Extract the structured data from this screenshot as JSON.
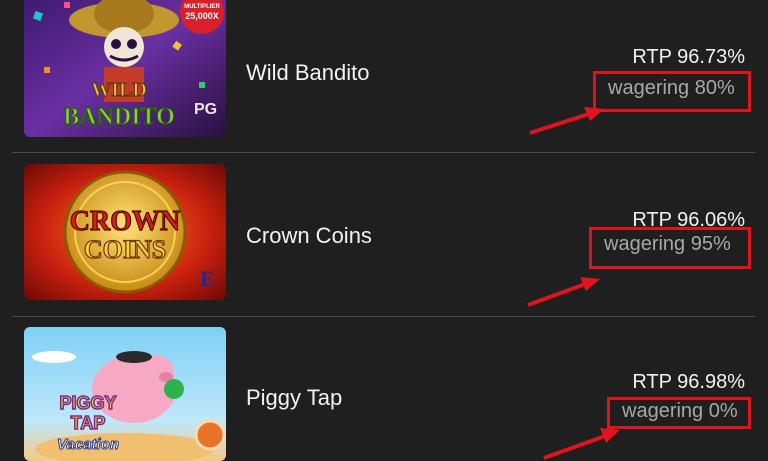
{
  "games": [
    {
      "title": "Wild Bandito",
      "rtp": "RTP 96.73%",
      "wagering": "wagering 80%",
      "thumb_text": {
        "badge_top": "MULTIPLIER",
        "badge_value": "25,000X",
        "logo_line1": "WILD",
        "logo_line2": "BANDITO",
        "provider": "PG"
      }
    },
    {
      "title": "Crown Coins",
      "rtp": "RTP 96.06%",
      "wagering": "wagering 95%",
      "thumb_text": {
        "logo_line1": "CROWN",
        "logo_line2": "COINS",
        "provider": "E"
      }
    },
    {
      "title": "Piggy Tap",
      "rtp": "RTP 96.98%",
      "wagering": "wagering 0%",
      "thumb_text": {
        "logo_line1": "PIGGY",
        "logo_line2": "TAP",
        "logo_line3": "Vacation"
      }
    }
  ],
  "colors": {
    "background": "#1f1f1f",
    "highlight": "#e0141e",
    "title": "#f2f2f2",
    "wagering_text": "#a8a8a8"
  },
  "icons": [
    "arrow-icon",
    "arrow-icon",
    "arrow-icon"
  ]
}
